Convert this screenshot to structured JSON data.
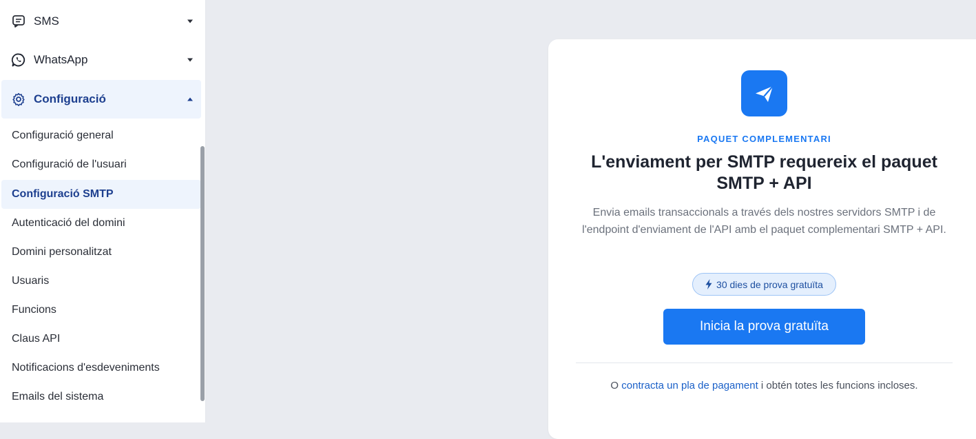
{
  "sidebar": {
    "groups": [
      {
        "label": "SMS",
        "icon": "sms-icon",
        "state": "collapsed"
      },
      {
        "label": "WhatsApp",
        "icon": "whatsapp-icon",
        "state": "collapsed"
      },
      {
        "label": "Configuració",
        "icon": "gear-icon",
        "state": "expanded"
      }
    ],
    "settings_items": [
      {
        "label": "Configuració general"
      },
      {
        "label": "Configuració de l'usuari"
      },
      {
        "label": "Configuració SMTP",
        "active": true
      },
      {
        "label": "Autenticació del domini"
      },
      {
        "label": "Domini personalitzat"
      },
      {
        "label": "Usuaris"
      },
      {
        "label": "Funcions"
      },
      {
        "label": "Claus API"
      },
      {
        "label": "Notificacions d'esdeveniments"
      },
      {
        "label": "Emails del sistema"
      }
    ]
  },
  "upsell": {
    "icon": "paper-plane-icon",
    "eyebrow": "PAQUET COMPLEMENTARI",
    "headline": "L'enviament per SMTP requereix el paquet SMTP + API",
    "description": "Envia emails transaccionals a través dels nostres servidors SMTP i de l'endpoint d'enviament de l'API amb el paquet complementari SMTP + API.",
    "badge": "30 dies de prova gratuïta",
    "cta": "Inicia la prova gratuïta",
    "footer_prefix": "O",
    "footer_link": "contracta un pla de pagament",
    "footer_suffix": "i obtén totes les funcions incloses."
  },
  "colors": {
    "accent": "#1a78f2",
    "active_text": "#1d3f8f",
    "active_bg": "#eef4fd",
    "page_bg": "#e9ebf0"
  }
}
